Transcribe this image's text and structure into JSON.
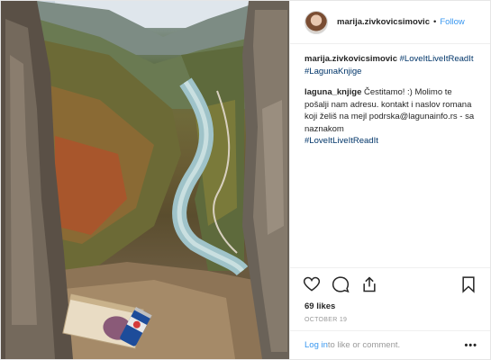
{
  "post": {
    "author": "marija.zivkovicsimovic",
    "separator": "•",
    "follow_label": "Follow",
    "image_alt": "Mountain canyon with river, a book and a can on a rock ledge",
    "comments": [
      {
        "user": "marija.zivkovicsimovic",
        "text": "",
        "tags": [
          "#LoveItLiveItReadIt",
          "#LagunaKnjige"
        ]
      },
      {
        "user": "laguna_knjige",
        "text": "Čestitamo! :) Molimo te pošalji nam adresu. kontakt i naslov romana koji želiš na mejl podrska@lagunainfo.rs - sa naznakom",
        "tags": [
          "#LoveItLiveItReadIt"
        ]
      }
    ],
    "actions": {
      "like_icon": "heart-icon",
      "comment_icon": "comment-icon",
      "share_icon": "share-icon",
      "save_icon": "bookmark-icon"
    },
    "likes": "69 likes",
    "date": "OCTOBER 19",
    "footer": {
      "login_label": "Log in",
      "rest": " to like or comment.",
      "more_label": "•••"
    }
  }
}
